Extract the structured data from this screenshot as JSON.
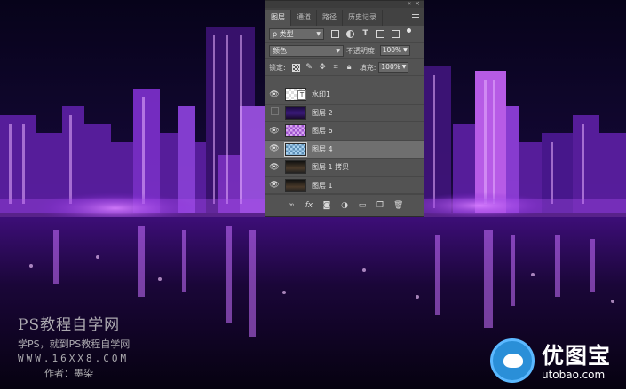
{
  "panel": {
    "tabs": [
      {
        "label": "图层",
        "active": true
      },
      {
        "label": "通道",
        "active": false
      },
      {
        "label": "路径",
        "active": false
      },
      {
        "label": "历史记录",
        "active": false
      }
    ],
    "filter": {
      "kind_label": "ρ 类型"
    },
    "blend": {
      "mode": "颜色",
      "opacity_label": "不透明度:",
      "opacity_value": "100%"
    },
    "lock": {
      "label": "锁定:",
      "fill_label": "填充:",
      "fill_value": "100%"
    },
    "layers": [
      {
        "name": "水印1",
        "visible": true,
        "thumb": "checker",
        "selected": false
      },
      {
        "name": "图层 2",
        "visible": false,
        "thumb": "city",
        "selected": false
      },
      {
        "name": "图层 6",
        "visible": true,
        "thumb": "purple",
        "selected": false
      },
      {
        "name": "图层 4",
        "visible": true,
        "thumb": "blue",
        "selected": true
      },
      {
        "name": "图层 1 拷贝",
        "visible": true,
        "thumb": "dark",
        "selected": false
      },
      {
        "name": "图层 1",
        "visible": true,
        "thumb": "dark",
        "selected": false
      }
    ],
    "bottom_icons": [
      "link-icon",
      "fx-icon",
      "mask-icon",
      "adjustment-icon",
      "folder-icon",
      "new-layer-icon",
      "trash-icon"
    ],
    "bottom_fx": "fx"
  },
  "watermark_left": {
    "line1": "PS教程自学网",
    "line2": "学PS，就到PS教程自学网",
    "line3": "WWW.16XX8.COM",
    "line4": "作者：墨染"
  },
  "watermark_right": {
    "brand": "优图宝",
    "url": "utobao.com"
  },
  "colors": {
    "panel_bg": "#535353",
    "selected_row": "#6f6f6f",
    "city_purple": "#9b30ff"
  }
}
